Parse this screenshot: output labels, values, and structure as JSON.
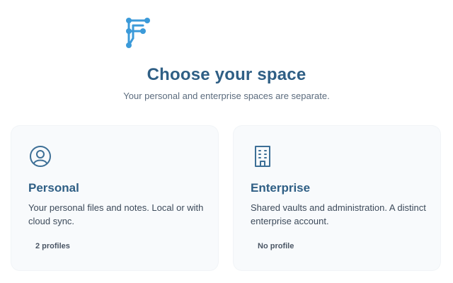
{
  "header": {
    "title": "Choose your space",
    "subtitle": "Your personal and enterprise spaces are separate."
  },
  "cards": [
    {
      "title": "Personal",
      "description": "Your personal files and notes. Local or with cloud sync.",
      "meta": "2 profiles",
      "icon": "user-circle-icon"
    },
    {
      "title": "Enterprise",
      "description": "Shared vaults and administration. A distinct enterprise account.",
      "meta": "No profile",
      "icon": "building-icon"
    }
  ],
  "colors": {
    "accent": "#2f5f85",
    "logo": "#3b9ad9",
    "card_background": "#f8fafc"
  }
}
